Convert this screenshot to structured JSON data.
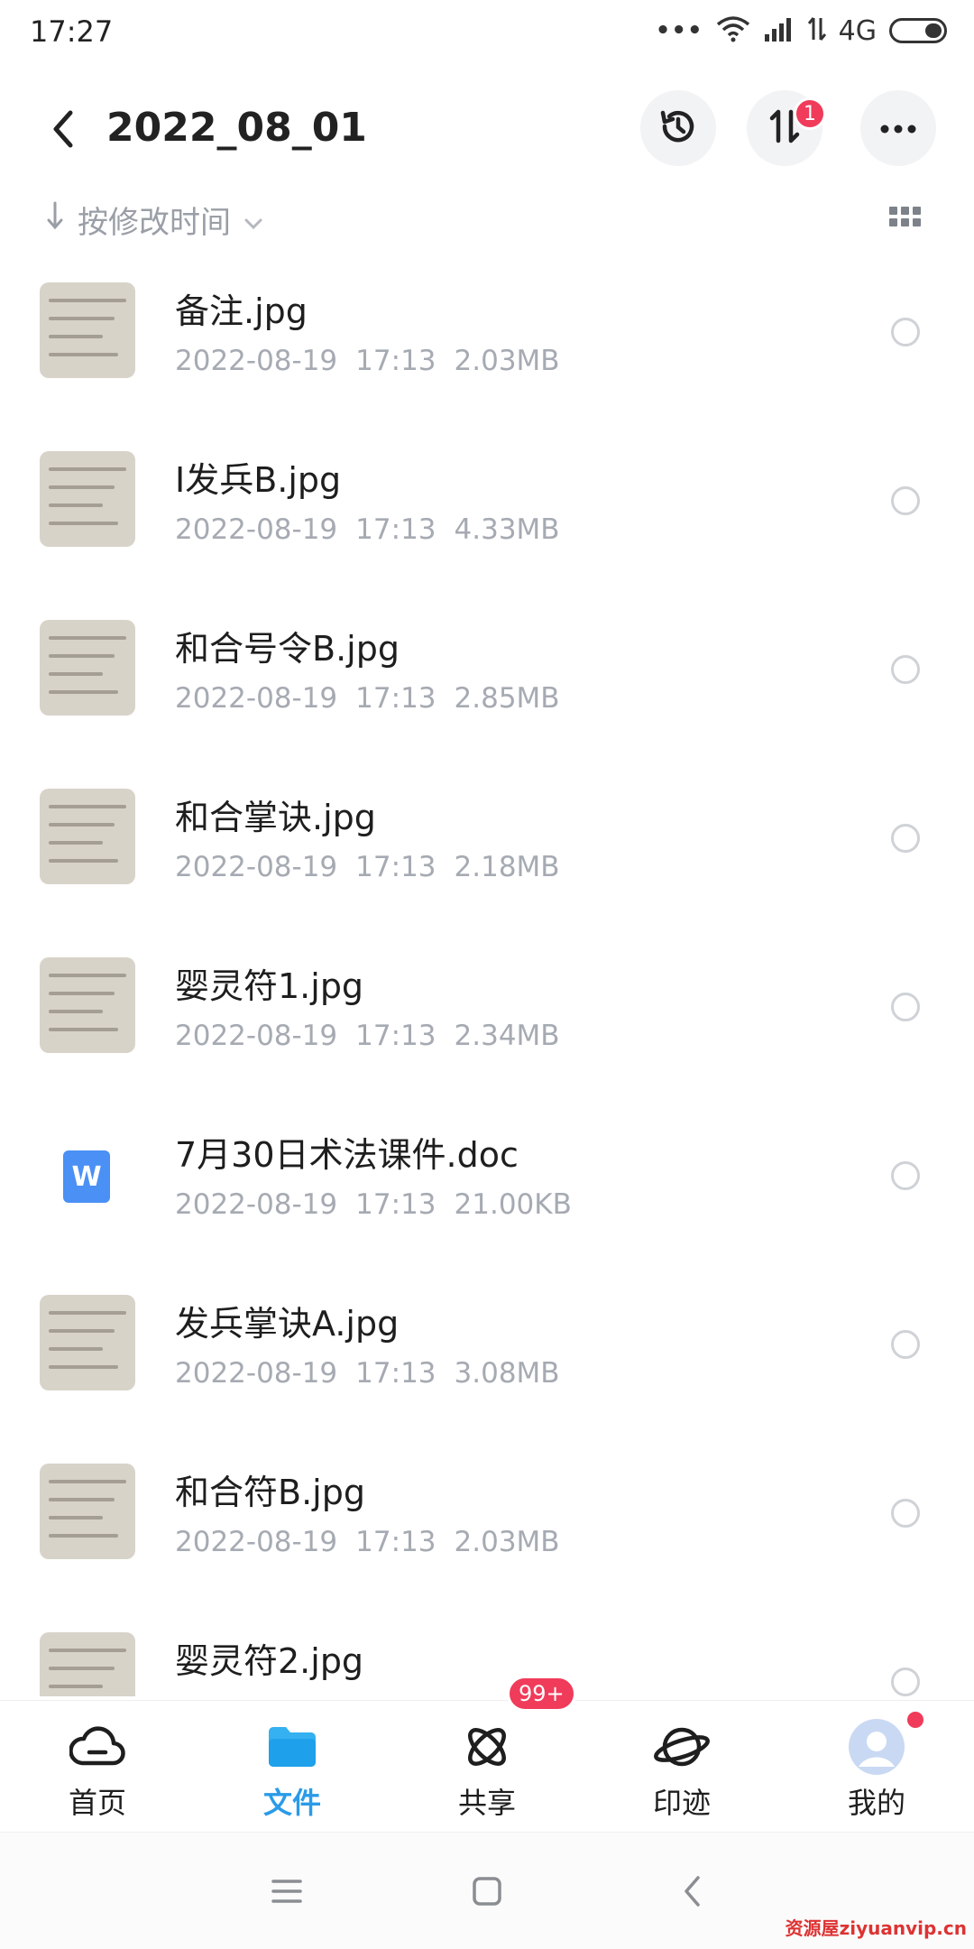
{
  "status_bar": {
    "time": "17:27",
    "dots": "•••",
    "network": "4G"
  },
  "header": {
    "title": "2022_08_01",
    "transfer_badge": "1",
    "icons": [
      "back-arrow-icon",
      "history-icon",
      "transfer-icon",
      "more-icon"
    ]
  },
  "sort": {
    "label": "按修改时间"
  },
  "files": [
    {
      "name": "备注.jpg",
      "date": "2022-08-19",
      "time": "17:13",
      "size": "2.03MB",
      "type": "image"
    },
    {
      "name": "I发兵B.jpg",
      "date": "2022-08-19",
      "time": "17:13",
      "size": "4.33MB",
      "type": "image"
    },
    {
      "name": "和合号令B.jpg",
      "date": "2022-08-19",
      "time": "17:13",
      "size": "2.85MB",
      "type": "image"
    },
    {
      "name": "和合掌诀.jpg",
      "date": "2022-08-19",
      "time": "17:13",
      "size": "2.18MB",
      "type": "image"
    },
    {
      "name": "婴灵符1.jpg",
      "date": "2022-08-19",
      "time": "17:13",
      "size": "2.34MB",
      "type": "image"
    },
    {
      "name": "7月30日术法课件.doc",
      "date": "2022-08-19",
      "time": "17:13",
      "size": "21.00KB",
      "type": "doc",
      "icon_letter": "W"
    },
    {
      "name": "发兵掌诀A.jpg",
      "date": "2022-08-19",
      "time": "17:13",
      "size": "3.08MB",
      "type": "image"
    },
    {
      "name": "和合符B.jpg",
      "date": "2022-08-19",
      "time": "17:13",
      "size": "2.03MB",
      "type": "image"
    },
    {
      "name": "婴灵符2.jpg",
      "type": "image"
    }
  ],
  "tabs": [
    {
      "label": "首页",
      "icon": "cloud-icon"
    },
    {
      "label": "文件",
      "icon": "folder-icon",
      "active": true
    },
    {
      "label": "共享",
      "icon": "share-orbit-icon",
      "badge": "99+"
    },
    {
      "label": "印迹",
      "icon": "planet-icon"
    },
    {
      "label": "我的",
      "icon": "avatar-icon"
    }
  ],
  "watermark": "资源屋ziyuanvip.cn",
  "colors": {
    "accent": "#2a9be8",
    "badge": "#f03b5a",
    "meta_text": "#a6aab2"
  }
}
